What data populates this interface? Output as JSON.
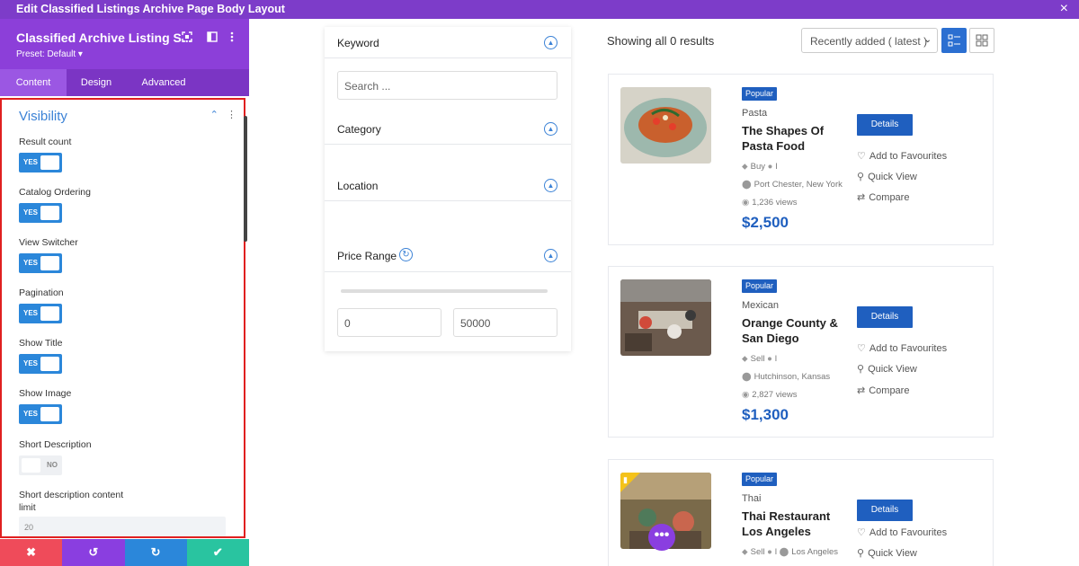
{
  "window": {
    "title": "Edit Classified Listings Archive Page Body Layout",
    "close_icon": "×"
  },
  "module": {
    "title": "Classified Archive Listing S...",
    "preset": "Preset: Default ▾"
  },
  "tabs": [
    {
      "label": "Content"
    },
    {
      "label": "Design"
    },
    {
      "label": "Advanced"
    }
  ],
  "section": {
    "title": "Visibility"
  },
  "options": [
    {
      "label": "Result count",
      "state": "YES"
    },
    {
      "label": "Catalog Ordering",
      "state": "YES"
    },
    {
      "label": "View Switcher",
      "state": "YES"
    },
    {
      "label": "Pagination",
      "state": "YES"
    },
    {
      "label": "Show Title",
      "state": "YES"
    },
    {
      "label": "Show Image",
      "state": "YES"
    },
    {
      "label": "Short Description",
      "state": "NO"
    }
  ],
  "short_desc_limit": {
    "label_line1": "Short description content",
    "label_line2": "limit",
    "value": "20"
  },
  "bottom_actions": [
    {
      "icon": "✖",
      "color": "#ef4b5a"
    },
    {
      "icon": "↺",
      "color": "#8a3ee0"
    },
    {
      "icon": "↻",
      "color": "#2b87da"
    },
    {
      "icon": "✔",
      "color": "#29c4a0"
    }
  ],
  "filters": {
    "keyword": "Keyword",
    "search_placeholder": "Search ...",
    "category": "Category",
    "location": "Location",
    "price_range": "Price Range",
    "price_min": "0",
    "price_max": "50000"
  },
  "results": {
    "count_text": "Showing all 0 results",
    "sort": "Recently added ( latest )"
  },
  "listings": [
    {
      "badge": "Popular",
      "category": "Pasta",
      "title_line1": "The Shapes Of",
      "title_line2": "Pasta Food",
      "type": "Buy",
      "author": "l",
      "location": "Port Chester, New York",
      "views": "1,236 views",
      "price": "$2,500",
      "details": "Details",
      "fav": "Add to Favourites",
      "quick": "Quick View",
      "compare": "Compare"
    },
    {
      "badge": "Popular",
      "category": "Mexican",
      "title_line1": "Orange County &",
      "title_line2": "San Diego",
      "type": "Sell",
      "author": "l",
      "location": "Hutchinson, Kansas",
      "views": "2,827 views",
      "price": "$1,300",
      "details": "Details",
      "fav": "Add to Favourites",
      "quick": "Quick View",
      "compare": "Compare"
    },
    {
      "badge": "Popular",
      "category": "Thai",
      "title_line1": "Thai Restaurant",
      "title_line2": "Los Angeles",
      "type": "Sell",
      "author": "l",
      "location": "Los Angeles",
      "details": "Details",
      "fav": "Add to Favourites",
      "quick": "Quick View"
    }
  ],
  "colors": {
    "purple": "#8c3fd9",
    "blue": "#1f5fbf",
    "toggle_blue": "#2b87da",
    "highlight_red": "#e02020"
  }
}
